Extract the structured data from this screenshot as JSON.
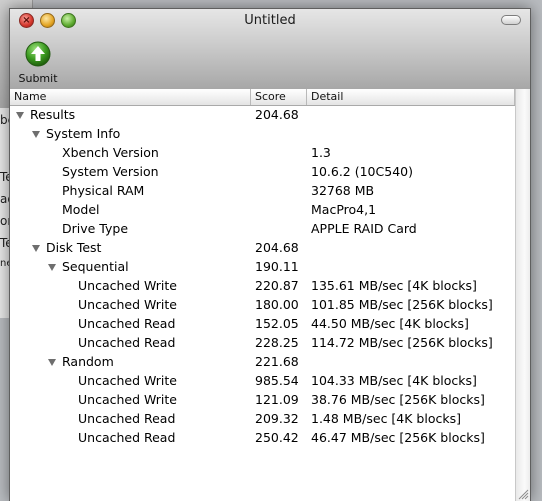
{
  "background_window": {
    "fragments": [
      "be",
      "Te",
      "ad",
      "or",
      "Te",
      "ne"
    ]
  },
  "window": {
    "title": "Untitled"
  },
  "toolbar": {
    "submit_label": "Submit",
    "submit_icon": "green-up-arrow-icon"
  },
  "table": {
    "headers": {
      "name": "Name",
      "score": "Score",
      "detail": "Detail"
    },
    "rows": [
      {
        "level": 0,
        "expanded": true,
        "name": "Results",
        "score": "204.68",
        "detail": ""
      },
      {
        "level": 1,
        "expanded": true,
        "name": "System Info",
        "score": "",
        "detail": ""
      },
      {
        "level": 2,
        "name": "Xbench Version",
        "score": "",
        "detail": "1.3"
      },
      {
        "level": 2,
        "name": "System Version",
        "score": "",
        "detail": "10.6.2 (10C540)"
      },
      {
        "level": 2,
        "name": "Physical RAM",
        "score": "",
        "detail": "32768 MB"
      },
      {
        "level": 2,
        "name": "Model",
        "score": "",
        "detail": "MacPro4,1"
      },
      {
        "level": 2,
        "name": "Drive Type",
        "score": "",
        "detail": "APPLE RAID Card"
      },
      {
        "level": 1,
        "expanded": true,
        "name": "Disk Test",
        "score": "204.68",
        "detail": ""
      },
      {
        "level": 2,
        "expanded": true,
        "name": "Sequential",
        "score": "190.11",
        "detail": ""
      },
      {
        "level": 3,
        "name": "Uncached Write",
        "score": "220.87",
        "detail": "135.61 MB/sec [4K blocks]"
      },
      {
        "level": 3,
        "name": "Uncached Write",
        "score": "180.00",
        "detail": "101.85 MB/sec [256K blocks]"
      },
      {
        "level": 3,
        "name": "Uncached Read",
        "score": "152.05",
        "detail": "44.50 MB/sec [4K blocks]"
      },
      {
        "level": 3,
        "name": "Uncached Read",
        "score": "228.25",
        "detail": "114.72 MB/sec [256K blocks]"
      },
      {
        "level": 2,
        "expanded": true,
        "name": "Random",
        "score": "221.68",
        "detail": ""
      },
      {
        "level": 3,
        "name": "Uncached Write",
        "score": "985.54",
        "detail": "104.33 MB/sec [4K blocks]"
      },
      {
        "level": 3,
        "name": "Uncached Write",
        "score": "121.09",
        "detail": "38.76 MB/sec [256K blocks]"
      },
      {
        "level": 3,
        "name": "Uncached Read",
        "score": "209.32",
        "detail": "1.48 MB/sec [4K blocks]"
      },
      {
        "level": 3,
        "name": "Uncached Read",
        "score": "250.42",
        "detail": "46.47 MB/sec [256K blocks]"
      }
    ]
  }
}
